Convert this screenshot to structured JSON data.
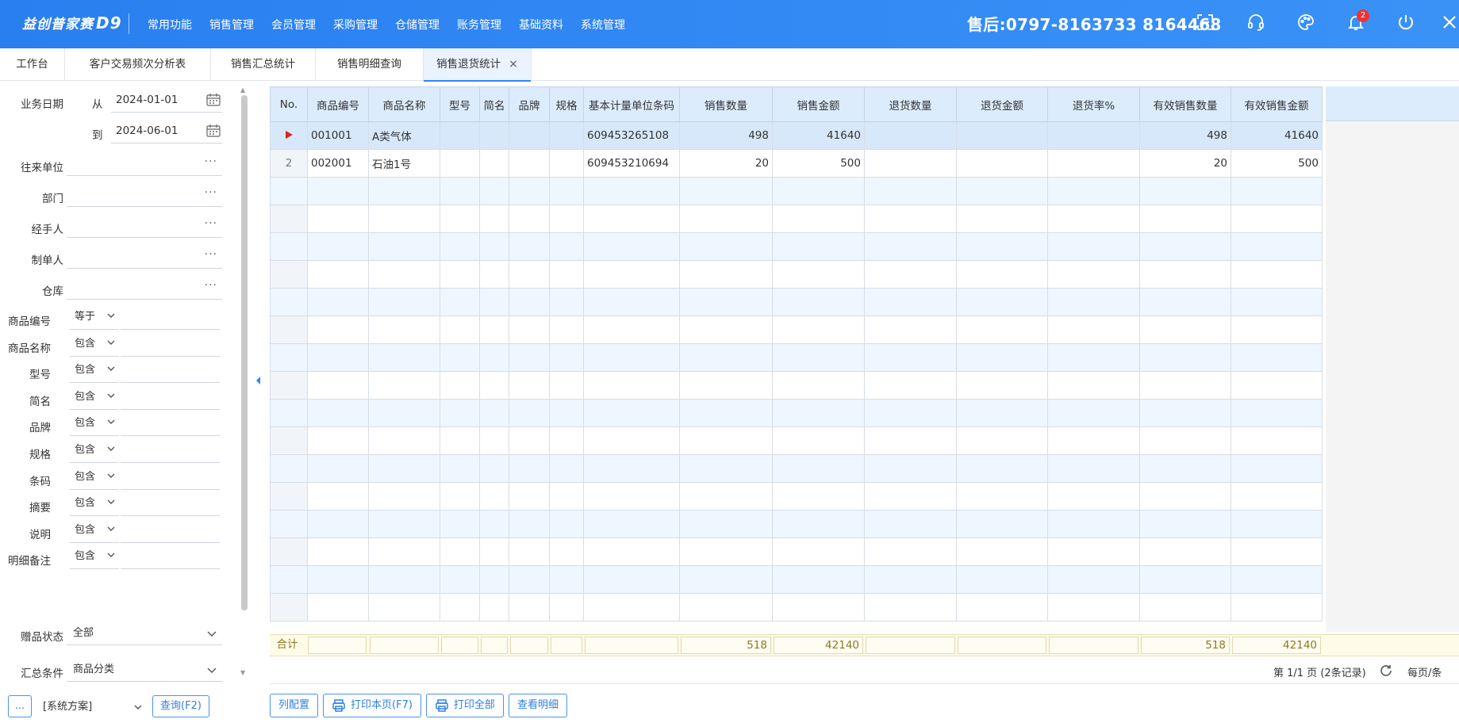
{
  "app": {
    "logo_text": "益创普家赛",
    "logo_suffix": "D9",
    "hotline": "售后:0797-8163733  8164468"
  },
  "menu": [
    "常用功能",
    "销售管理",
    "会员管理",
    "采购管理",
    "仓储管理",
    "账务管理",
    "基础资料",
    "系统管理"
  ],
  "topicons": {
    "notify_count": "2"
  },
  "tabs": [
    {
      "label": "工作台"
    },
    {
      "label": "客户交易频次分析表"
    },
    {
      "label": "销售汇总统计"
    },
    {
      "label": "销售明细查询"
    },
    {
      "label": "销售退货统计",
      "close": "×"
    }
  ],
  "filters": {
    "date_label": "业务日期",
    "from_label": "从",
    "from_value": "2024-01-01",
    "to_label": "到",
    "to_value": "2024-06-01",
    "party_label": "往来单位",
    "dept_label": "部门",
    "handler_label": "经手人",
    "maker_label": "制单人",
    "warehouse_label": "仓库",
    "dots": "···",
    "op_rows": [
      {
        "label": "商品编号",
        "op": "等于"
      },
      {
        "label": "商品名称",
        "op": "包含"
      },
      {
        "label": "型号",
        "op": "包含"
      },
      {
        "label": "简名",
        "op": "包含"
      },
      {
        "label": "品牌",
        "op": "包含"
      },
      {
        "label": "规格",
        "op": "包含"
      },
      {
        "label": "条码",
        "op": "包含"
      },
      {
        "label": "摘要",
        "op": "包含"
      },
      {
        "label": "说明",
        "op": "包含"
      },
      {
        "label": "明细备注",
        "op": "包含"
      }
    ],
    "gift_label": "赠品状态",
    "gift_value": "全部",
    "group_label": "汇总条件",
    "group_value": "商品分类"
  },
  "left_buttons": {
    "more": "...",
    "scheme": "[系统方案]",
    "query": "查询(F2)"
  },
  "grid": {
    "columns": [
      "No.",
      "商品编号",
      "商品名称",
      "型号",
      "简名",
      "品牌",
      "规格",
      "基本计量单位条码",
      "销售数量",
      "销售金额",
      "退货数量",
      "退货金额",
      "退货率%",
      "有效销售数量",
      "有效销售金额"
    ],
    "rows": [
      {
        "no": "",
        "code": "001001",
        "name": "A类气体",
        "model": "",
        "short": "",
        "brand": "",
        "spec": "",
        "barcode": "609453265108",
        "sale_qty": "498",
        "sale_amt": "41640",
        "ret_qty": "",
        "ret_amt": "",
        "ret_rate": "",
        "eff_qty": "498",
        "eff_amt": "41640"
      },
      {
        "no": "2",
        "code": "002001",
        "name": "石油1号",
        "model": "",
        "short": "",
        "brand": "",
        "spec": "",
        "barcode": "609453210694",
        "sale_qty": "20",
        "sale_amt": "500",
        "ret_qty": "",
        "ret_amt": "",
        "ret_rate": "",
        "eff_qty": "20",
        "eff_amt": "500"
      }
    ],
    "totals": {
      "label": "合计",
      "sale_qty": "518",
      "sale_amt": "42140",
      "eff_qty": "518",
      "eff_amt": "42140"
    }
  },
  "pager": {
    "info": "第 1/1 页 (2条记录)",
    "per_page": "每页/条"
  },
  "bottom_buttons": {
    "columns": "列配置",
    "print_page": "打印本页(F7)",
    "print_all": "打印全部",
    "view_detail": "查看明细"
  }
}
